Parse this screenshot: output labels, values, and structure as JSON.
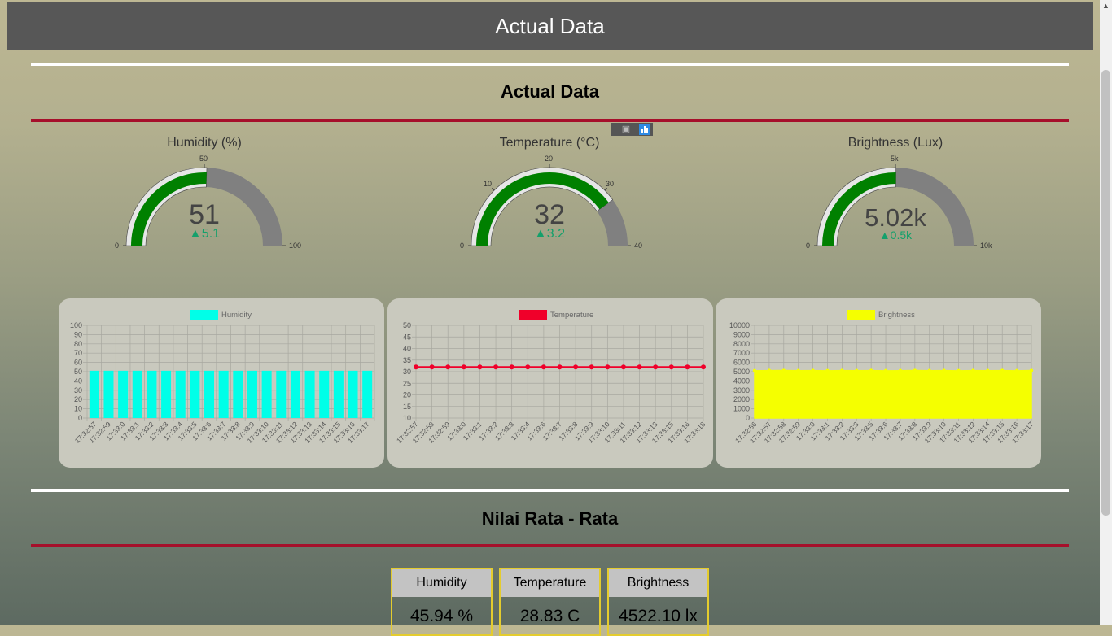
{
  "header": {
    "title": "Actual Data"
  },
  "sections": {
    "actual_title": "Actual Data",
    "average_title": "Nilai Rata - Rata"
  },
  "gauges": [
    {
      "title": "Humidity (%)",
      "value": "51",
      "delta": "▲5.1",
      "min": 0,
      "max": 100,
      "ticks": [
        "0",
        "50",
        "100"
      ],
      "fraction": 0.51,
      "color": "#008000"
    },
    {
      "title": "Temperature (°C)",
      "value": "32",
      "delta": "▲3.2",
      "min": 0,
      "max": 40,
      "ticks": [
        "0",
        "10",
        "20",
        "30",
        "40"
      ],
      "fraction": 0.8,
      "color": "#008000"
    },
    {
      "title": "Brightness (Lux)",
      "value": "5.02k",
      "delta": "▲0.5k",
      "min": 0,
      "max": 10000,
      "ticks": [
        "0",
        "5k",
        "10k"
      ],
      "fraction": 0.502,
      "color": "#008000"
    }
  ],
  "chart_data": [
    {
      "type": "bar",
      "legend": "Humidity",
      "color": "#00ffe8",
      "ylim": [
        0,
        100
      ],
      "yticks": [
        0,
        10,
        20,
        30,
        40,
        50,
        60,
        70,
        80,
        90,
        100
      ],
      "categories": [
        "17:32:57",
        "17:32:59",
        "17:33:0",
        "17:33:1",
        "17:33:2",
        "17:33:3",
        "17:33:4",
        "17:33:5",
        "17:33:6",
        "17:33:7",
        "17:33:8",
        "17:33:9",
        "17:33:10",
        "17:33:11",
        "17:33:12",
        "17:33:13",
        "17:33:14",
        "17:33:15",
        "17:33:16",
        "17:33:17"
      ],
      "values": [
        51,
        51,
        51,
        51,
        51,
        51,
        51,
        51,
        51,
        51,
        51,
        51,
        51,
        51,
        51,
        51,
        51,
        51,
        51,
        51
      ]
    },
    {
      "type": "line",
      "legend": "Temperature",
      "color": "#f0002a",
      "ylim": [
        10,
        50
      ],
      "yticks": [
        10,
        15,
        20,
        25,
        30,
        35,
        40,
        45,
        50
      ],
      "categories": [
        "17:32:57",
        "17:32:58",
        "17:32:59",
        "17:33:0",
        "17:33:1",
        "17:33:2",
        "17:33:3",
        "17:33:4",
        "17:33:6",
        "17:33:7",
        "17:33:8",
        "17:33:9",
        "17:33:10",
        "17:33:11",
        "17:33:12",
        "17:33:13",
        "17:33:15",
        "17:33:16",
        "17:33:18"
      ],
      "values": [
        32,
        32,
        32,
        32,
        32,
        32,
        32,
        32,
        32,
        32,
        32,
        32,
        32,
        32,
        32,
        32,
        32,
        32,
        32
      ]
    },
    {
      "type": "area",
      "legend": "Brightness",
      "color": "#f5ff00",
      "ylim": [
        0,
        10000
      ],
      "yticks": [
        0,
        1000,
        2000,
        3000,
        4000,
        5000,
        6000,
        7000,
        8000,
        9000,
        10000
      ],
      "categories": [
        "17:32:56",
        "17:32:57",
        "17:32:58",
        "17:32:59",
        "17:33:0",
        "17:33:1",
        "17:33:2",
        "17:33:3",
        "17:33:5",
        "17:33:6",
        "17:33:7",
        "17:33:8",
        "17:33:9",
        "17:33:10",
        "17:33:11",
        "17:33:12",
        "17:33:14",
        "17:33:15",
        "17:33:16",
        "17:33:17"
      ],
      "values": [
        5100,
        5120,
        5130,
        5110,
        5120,
        5100,
        5120,
        5110,
        5120,
        5100,
        5110,
        5130,
        5110,
        5120,
        5100,
        5120,
        5110,
        5120,
        5100,
        5130
      ]
    }
  ],
  "averages": [
    {
      "label": "Humidity",
      "value": "45.94 %"
    },
    {
      "label": "Temperature",
      "value": "28.83 C"
    },
    {
      "label": "Brightness",
      "value": "4522.10 lx"
    }
  ]
}
